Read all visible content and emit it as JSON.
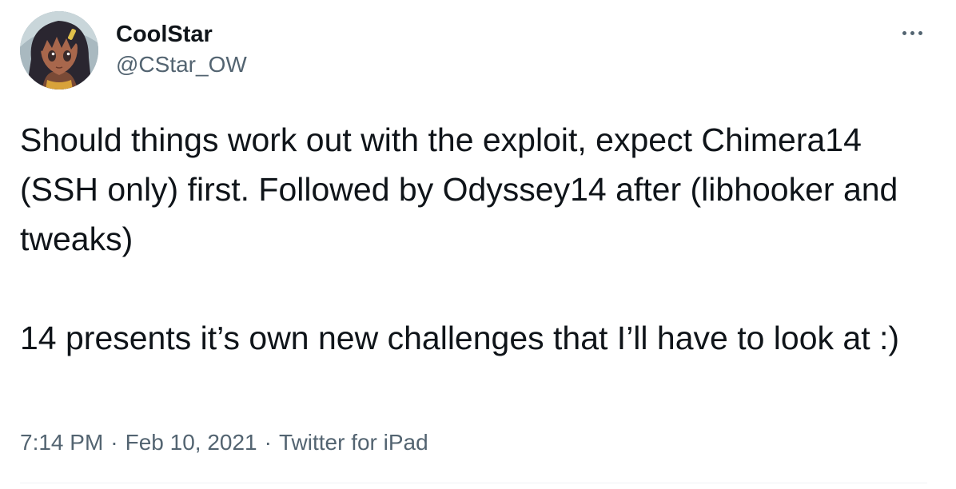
{
  "author": {
    "display_name": "CoolStar",
    "handle": "@CStar_OW",
    "avatar_icon": "anime-character-avatar"
  },
  "menu": {
    "more_icon": "more-horizontal-icon"
  },
  "tweet": {
    "text": "Should things work out with the exploit, expect Chimera14 (SSH only) first. Followed by Odyssey14 after (libhooker and tweaks)\n\n14 presents it’s own new challenges that I’ll have to look at :)"
  },
  "meta": {
    "time": "7:14 PM",
    "separator": "·",
    "date": "Feb 10, 2021",
    "source": "Twitter for iPad"
  },
  "colors": {
    "text": "#0f1419",
    "secondary_text": "#536471",
    "divider": "#eff3f4",
    "background": "#ffffff"
  }
}
